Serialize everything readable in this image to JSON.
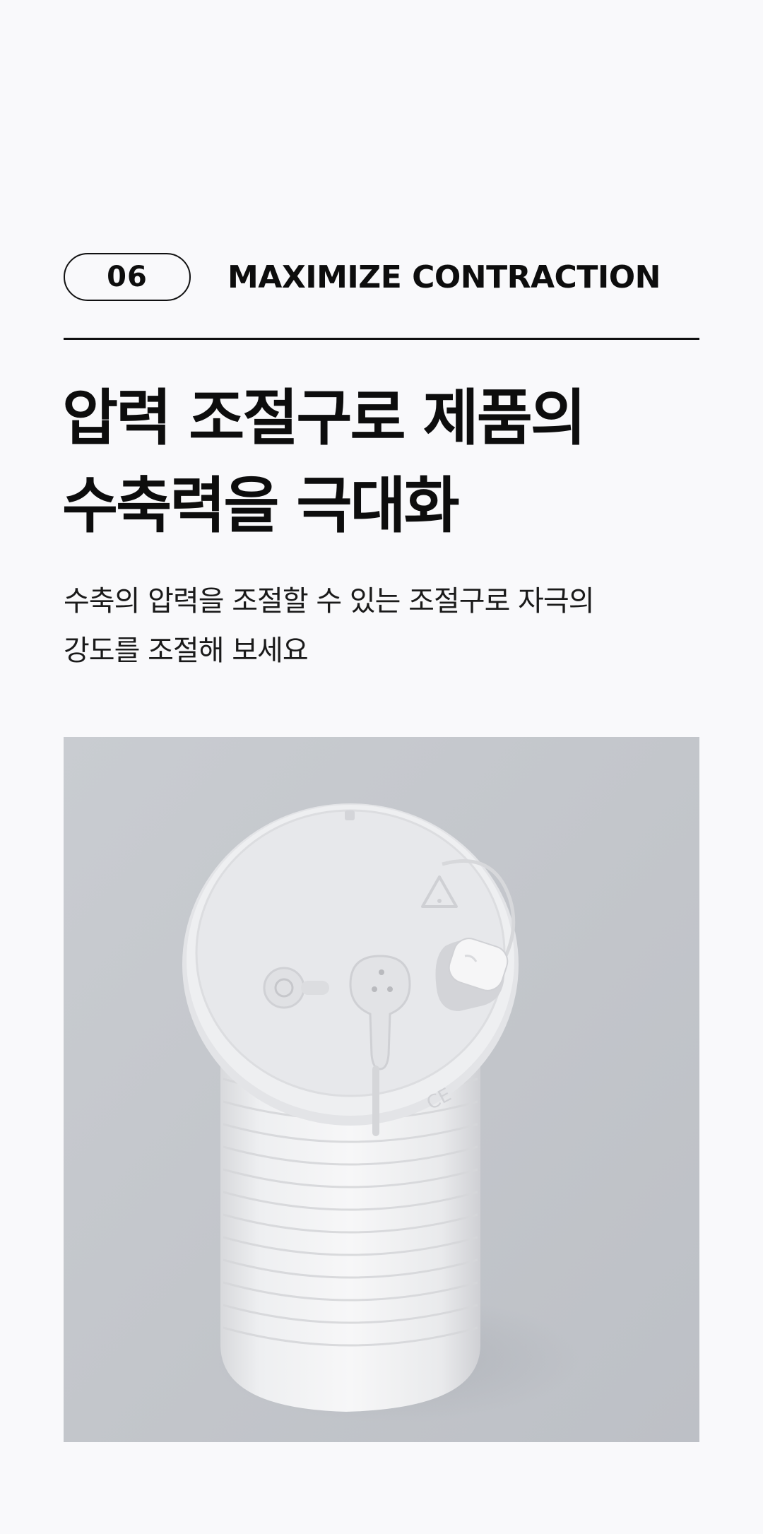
{
  "section": {
    "number": "06",
    "title": "MAXIMIZE CONTRACTION"
  },
  "headline": {
    "line1": "압력 조절구로 제품의",
    "line2": "수축력을 극대화"
  },
  "description": {
    "line1": "수축의 압력을 조절할 수 있는 조절구로 자극의",
    "line2": "강도를 조절해 보세요"
  },
  "product_image": {
    "icon": "product-photo",
    "colors": {
      "background": "#c4c7cc",
      "product": "#f2f2f3"
    }
  }
}
